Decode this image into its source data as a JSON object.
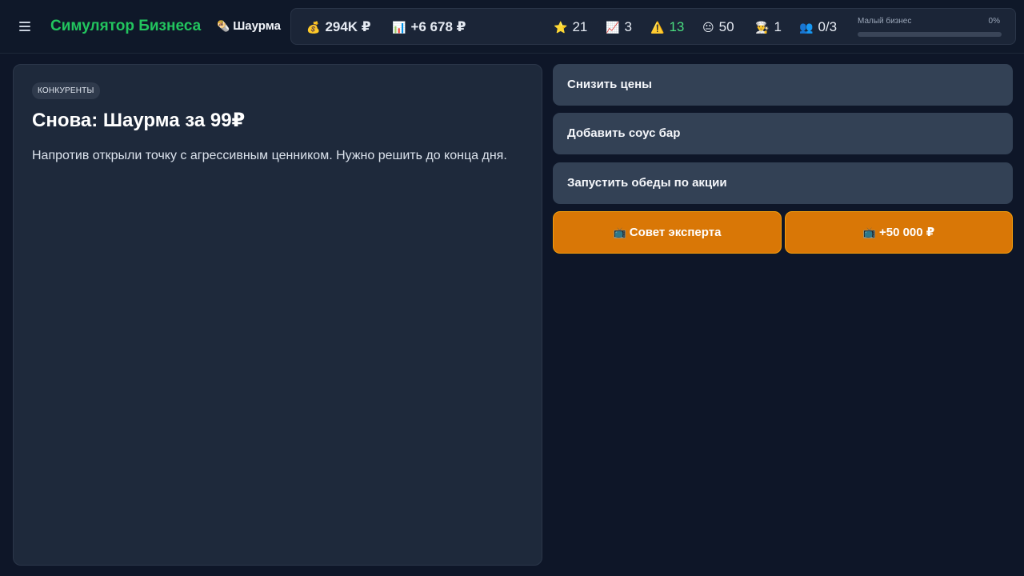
{
  "header": {
    "app_title": "Симулятор Бизнеса",
    "business_icon": "🌯",
    "business_name": "Шаурма"
  },
  "stats": {
    "money": {
      "icon": "💰",
      "value": "294K ₽"
    },
    "income": {
      "icon": "📊",
      "value": "+6 678 ₽"
    },
    "rating": {
      "icon": "⭐",
      "value": "21"
    },
    "growth": {
      "icon": "📈",
      "value": "3"
    },
    "warnings": {
      "icon": "⚠️",
      "value": "13"
    },
    "mood": {
      "icon": "😐",
      "value": "50"
    },
    "staff": {
      "icon": "👨‍🍳",
      "value": "1"
    },
    "team": {
      "icon": "👥",
      "value": "0/3"
    },
    "level": {
      "label": "Малый бизнес",
      "percent_text": "0%",
      "progress": 0
    }
  },
  "event": {
    "tag": "КОНКУРЕНТЫ",
    "title": "Снова: Шаурма за 99₽",
    "description": "Напротив открыли точку с агрессивным ценником. Нужно решить до конца дня."
  },
  "choices": [
    {
      "label": "Снизить цены"
    },
    {
      "label": "Добавить соус бар"
    },
    {
      "label": "Запустить обеды по акции"
    }
  ],
  "actions": {
    "expert": {
      "icon": "📺",
      "label": "Совет эксперта"
    },
    "bonus": {
      "icon": "📺",
      "label": "+50 000 ₽"
    }
  },
  "colors": {
    "accent_green": "#22c55e",
    "orange": "#d97706",
    "background": "#0e1628",
    "card": "#1e293b",
    "choice": "#334155"
  }
}
